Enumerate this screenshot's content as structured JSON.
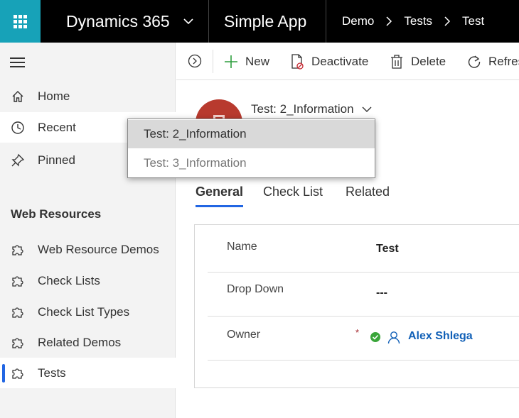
{
  "topbar": {
    "product_name": "Dynamics 365",
    "app_name": "Simple App",
    "breadcrumb": [
      "Demo",
      "Tests",
      "Test"
    ]
  },
  "sidebar": {
    "items": [
      {
        "label": "Home",
        "icon": "home-icon"
      },
      {
        "label": "Recent",
        "icon": "clock-icon"
      },
      {
        "label": "Pinned",
        "icon": "pin-icon"
      }
    ],
    "section_title": "Web Resources",
    "entities": [
      {
        "label": "Web Resource Demos",
        "icon": "puzzle-icon"
      },
      {
        "label": "Check Lists",
        "icon": "puzzle-icon"
      },
      {
        "label": "Check List Types",
        "icon": "puzzle-icon"
      },
      {
        "label": "Related Demos",
        "icon": "puzzle-icon"
      },
      {
        "label": "Tests",
        "icon": "puzzle-icon",
        "active": true
      }
    ]
  },
  "commands": {
    "new": "New",
    "deactivate": "Deactivate",
    "delete": "Delete",
    "refresh": "Refresh"
  },
  "record": {
    "form_selector": "Test: 2_Information"
  },
  "form_dropdown": {
    "options": [
      "Test: 2_Information",
      "Test: 3_Information"
    ],
    "selected": "Test: 2_Information"
  },
  "tabs": [
    "General",
    "Check List",
    "Related"
  ],
  "fields": {
    "name": {
      "label": "Name",
      "value": "Test"
    },
    "dropdown": {
      "label": "Drop Down",
      "value": "---"
    },
    "owner": {
      "label": "Owner",
      "required_mark": "*",
      "value": "Alex Shlega"
    }
  },
  "colors": {
    "waffle": "#17a2b8",
    "accent": "#2266e3",
    "avatar": "#b83a2e",
    "link": "#1160b7",
    "required": "#a4262c",
    "ok": "#3aa53a"
  }
}
